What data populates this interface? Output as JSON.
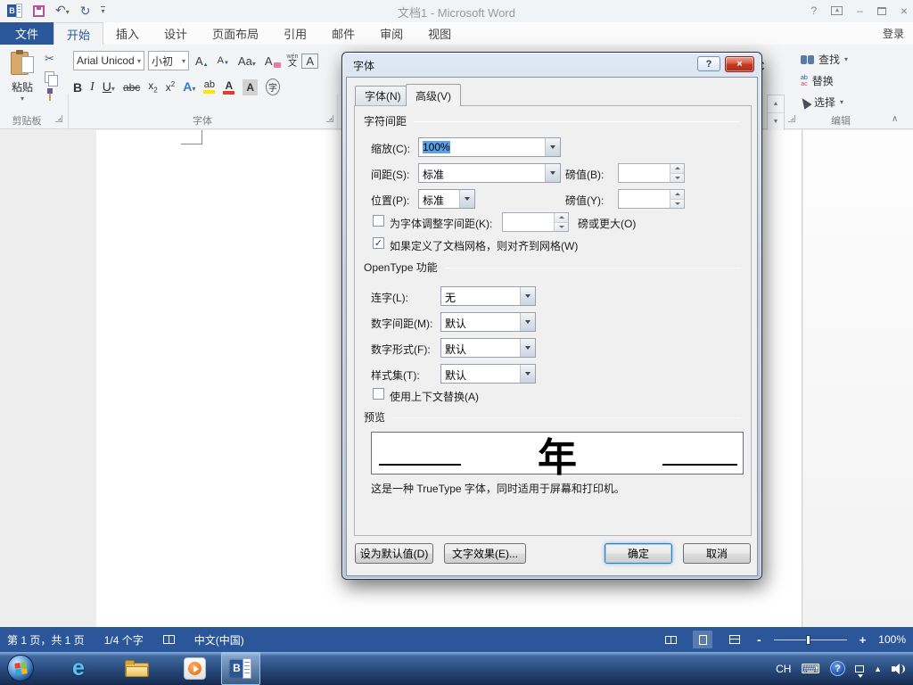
{
  "colors": {
    "accent": "#2b579a",
    "status_bar": "#2b579a",
    "selection_highlight": "#5aa2e8",
    "dialog_close_red": "#c03a22",
    "taskbar_blue": "#2a4d80"
  },
  "icons": {
    "check": "✓",
    "undo": "↶",
    "redo": "↻",
    "scissors": "✂",
    "dropdown": "▼",
    "small_dropdown": "▾",
    "up_triangle": "▲",
    "collapse_chevron": "∧",
    "help": "?",
    "minimize": "–",
    "close": "×",
    "ie_letter": "e"
  },
  "titlebar": {
    "title": "文档1 - Microsoft Word",
    "sign_in": "登录"
  },
  "ribbon_tabs": [
    "文件",
    "开始",
    "插入",
    "设计",
    "页面布局",
    "引用",
    "邮件",
    "审阅",
    "视图"
  ],
  "clipboard": {
    "paste": "粘贴",
    "group": "剪贴板"
  },
  "font_group": {
    "name": "Arial Unicod",
    "size": "小初",
    "grow": "A",
    "shrink": "A",
    "case_btn": "Aa",
    "clear": "A",
    "phon_top": "wén",
    "phon_bottom": "文",
    "border_btn": "A",
    "bold": "B",
    "italic": "I",
    "underline": "U",
    "strike": "abc",
    "sub_base": "x",
    "sub_script": "2",
    "sup_base": "x",
    "sup_script": "2",
    "effects": "A",
    "highlight": "ab",
    "color_btn": "A",
    "shading": "A",
    "enclose": "字",
    "group": "字体"
  },
  "styles_fragment": {
    "partial": "C"
  },
  "editing": {
    "find": "查找",
    "replace": "替换",
    "select": "选择",
    "replace_top": "ab",
    "replace_bottom": "ac",
    "group": "编辑"
  },
  "dialog": {
    "title": "字体",
    "tab_font": "字体(N)",
    "tab_advanced": "高级(V)",
    "char_spacing": {
      "header": "字符间距",
      "scale_label": "缩放(C):",
      "scale_value": "100%",
      "spacing_label": "间距(S):",
      "spacing_value": "标准",
      "by_b_label": "磅值(B):",
      "by_b_value": "",
      "position_label": "位置(P):",
      "position_value": "标准",
      "by_y_label": "磅值(Y):",
      "by_y_value": "",
      "kerning_label": "为字体调整字间距(K):",
      "kerning_value": "",
      "kerning_checked": false,
      "kerning_suffix": "磅或更大(O)",
      "grid_label": "如果定义了文档网格，则对齐到网格(W)",
      "grid_checked": true
    },
    "opentype": {
      "header": "OpenType 功能",
      "ligatures_label": "连字(L):",
      "ligatures_value": "无",
      "numspacing_label": "数字间距(M):",
      "numspacing_value": "默认",
      "numforms_label": "数字形式(F):",
      "numforms_value": "默认",
      "styleset_label": "样式集(T):",
      "styleset_value": "默认",
      "contextual_label": "使用上下文替换(A)",
      "contextual_checked": false
    },
    "preview": {
      "header": "预览",
      "sample": "年",
      "note": "这是一种 TrueType 字体，同时适用于屏幕和打印机。"
    },
    "buttons": {
      "set_default": "设为默认值(D)",
      "text_effects": "文字效果(E)...",
      "ok": "确定",
      "cancel": "取消"
    }
  },
  "status_bar": {
    "page_info": "第 1 页，共 1 页",
    "word_count": "1/4 个字",
    "language": "中文(中国)",
    "zoom_out": "-",
    "zoom_in": "+",
    "zoom_level": "100%"
  },
  "tray": {
    "language": "CH"
  }
}
